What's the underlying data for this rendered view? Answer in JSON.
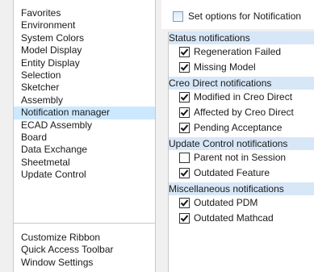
{
  "left_panel": {
    "categories": [
      "Favorites",
      "Environment",
      "System Colors",
      "Model Display",
      "Entity Display",
      "Selection",
      "Sketcher",
      "Assembly",
      "Notification manager",
      "ECAD Assembly",
      "Board",
      "Data Exchange",
      "Sheetmetal",
      "Update Control"
    ],
    "selected": "Notification manager",
    "extra_items": [
      "Customize Ribbon",
      "Quick Access Toolbar",
      "Window Settings"
    ]
  },
  "options_panel": {
    "set_options_label": "Set options for Notification",
    "groups": [
      {
        "title": "Status notifications",
        "items": [
          {
            "label": "Regeneration Failed",
            "checked": true
          },
          {
            "label": "Missing Model",
            "checked": true
          }
        ]
      },
      {
        "title": "Creo Direct notifications",
        "items": [
          {
            "label": "Modified in Creo Direct",
            "checked": true
          },
          {
            "label": "Affected by Creo Direct",
            "checked": true
          },
          {
            "label": "Pending Acceptance",
            "checked": true
          }
        ]
      },
      {
        "title": "Update Control notifications",
        "items": [
          {
            "label": "Parent not in Session",
            "checked": false
          },
          {
            "label": "Outdated Feature",
            "checked": true
          }
        ]
      },
      {
        "title": "Miscellaneous notifications",
        "items": [
          {
            "label": "Outdated PDM",
            "checked": true
          },
          {
            "label": "Outdated Mathcad",
            "checked": true
          }
        ]
      }
    ]
  },
  "colors": {
    "selection_highlight": "#cce8ff",
    "group_header_bg": "#d7e7f7"
  }
}
